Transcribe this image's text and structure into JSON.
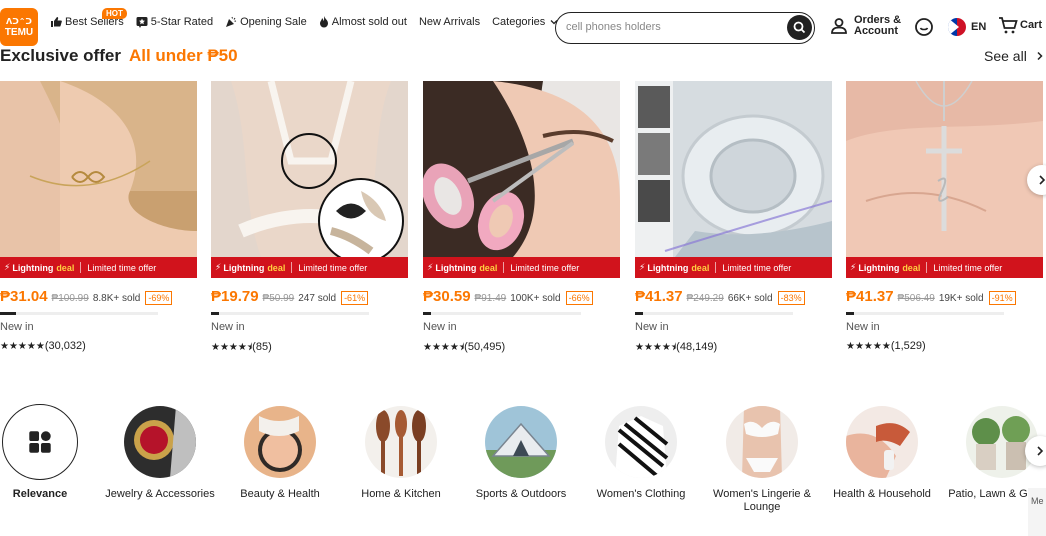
{
  "header": {
    "logo_text_top": "ᐱᑐ⌃ᑐ",
    "logo_text": "TEMU",
    "nav": [
      {
        "label": "Best Sellers",
        "icon": "thumbs-up-icon",
        "badge": "HOT"
      },
      {
        "label": "5-Star Rated",
        "icon": "star-badge-icon"
      },
      {
        "label": "Opening Sale",
        "icon": "party-icon"
      },
      {
        "label": "Almost sold out",
        "icon": "flame-icon"
      },
      {
        "label": "New Arrivals"
      },
      {
        "label": "Categories",
        "icon": "chevron-down-icon"
      }
    ],
    "search_placeholder": "cell phones holders",
    "orders_line1": "Orders &",
    "orders_line2": "Account",
    "lang": "EN",
    "cart": "Cart"
  },
  "section": {
    "title": "Exclusive offer",
    "accent": "All under ₱50",
    "see_all": "See all"
  },
  "deal_banner": {
    "bolt": "⚡",
    "lightning": "Lightning",
    "deal": "deal",
    "limited": "Limited time offer"
  },
  "products": [
    {
      "price": "₱31.04",
      "old_price": "₱100.99",
      "sold": "8.8K+ sold",
      "discount": "-69%",
      "sold_progress": 0.1,
      "newin": "New in",
      "stars": "★★★★★",
      "reviews": "(30,032)"
    },
    {
      "price": "₱19.79",
      "old_price": "₱50.99",
      "sold": "247 sold",
      "discount": "-61%",
      "sold_progress": 0.05,
      "newin": "New in",
      "stars": "★★★★⯨",
      "reviews": "(85)"
    },
    {
      "price": "₱30.59",
      "old_price": "₱91.49",
      "sold": "100K+ sold",
      "discount": "-66%",
      "sold_progress": 0.05,
      "newin": "New in",
      "stars": "★★★★⯨",
      "reviews": "(50,495)"
    },
    {
      "price": "₱41.37",
      "old_price": "₱249.29",
      "sold": "66K+ sold",
      "discount": "-83%",
      "sold_progress": 0.05,
      "newin": "New in",
      "stars": "★★★★⯨",
      "reviews": "(48,149)"
    },
    {
      "price": "₱41.37",
      "old_price": "₱506.49",
      "sold": "19K+ sold",
      "discount": "-91%",
      "sold_progress": 0.05,
      "newin": "New in",
      "stars": "★★★★★",
      "reviews": "(1,529)"
    }
  ],
  "categories": [
    {
      "label": "Relevance"
    },
    {
      "label": "Jewelry & Accessories"
    },
    {
      "label": "Beauty & Health"
    },
    {
      "label": "Home & Kitchen"
    },
    {
      "label": "Sports & Outdoors"
    },
    {
      "label": "Women's Clothing"
    },
    {
      "label": "Women's Lingerie & Lounge"
    },
    {
      "label": "Health & Household"
    },
    {
      "label": "Patio, Lawn & Garden"
    }
  ],
  "side_tab": "Me",
  "colors": {
    "brand": "#fb7701",
    "deal_red": "#d1131c"
  }
}
